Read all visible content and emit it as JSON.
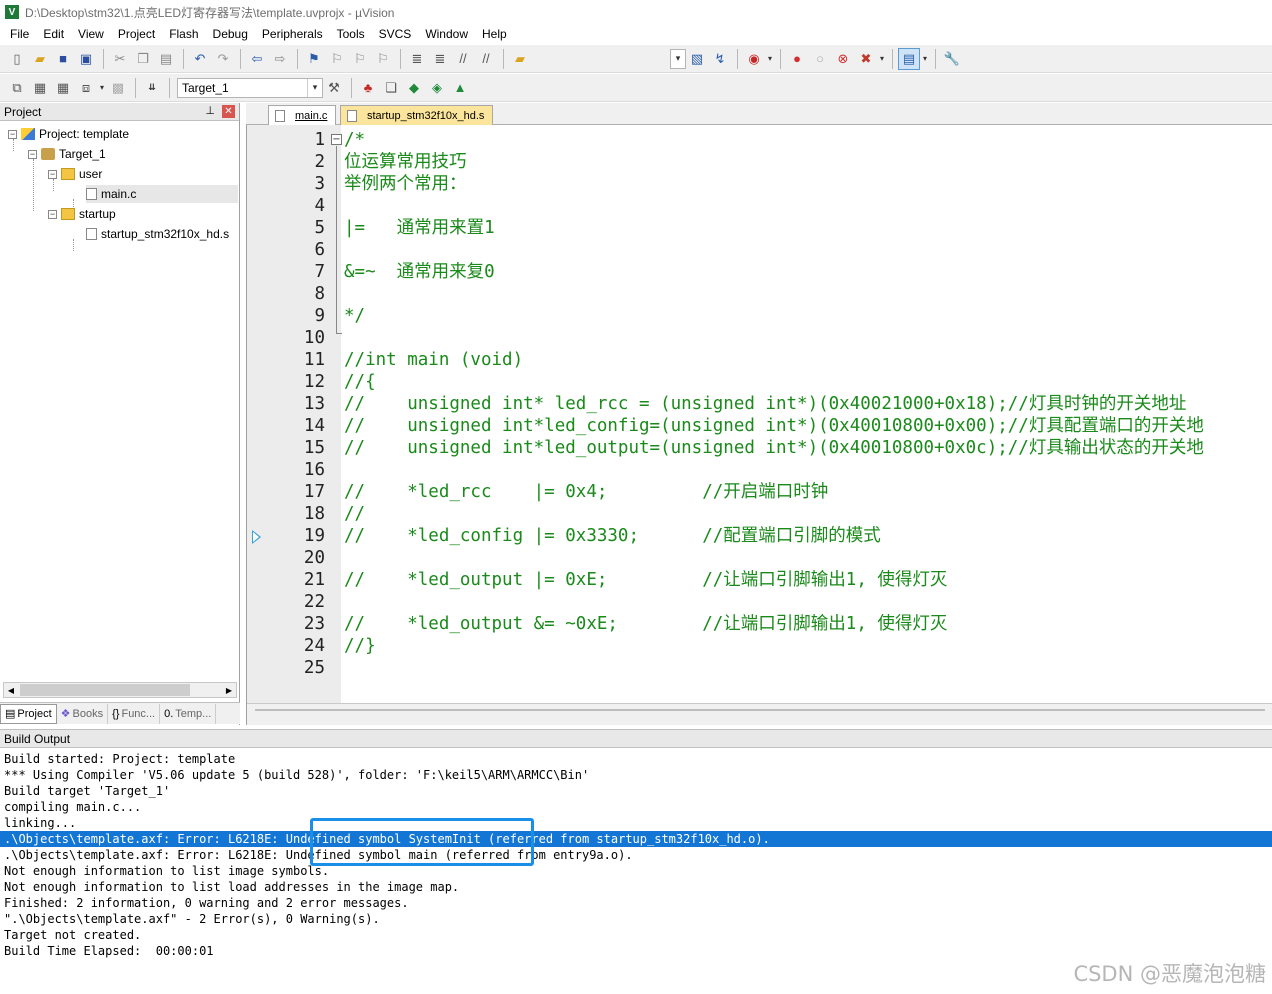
{
  "window": {
    "title": "D:\\Desktop\\stm32\\1.点亮LED灯寄存器写法\\template.uvprojx - µVision",
    "app_icon": "V"
  },
  "menu": [
    "File",
    "Edit",
    "View",
    "Project",
    "Flash",
    "Debug",
    "Peripherals",
    "Tools",
    "SVCS",
    "Window",
    "Help"
  ],
  "toolbar": {
    "target_combo": "Target_1"
  },
  "project_panel": {
    "title": "Project",
    "tree": {
      "project": "Project: template",
      "target": "Target_1",
      "group_user": "user",
      "file_main": "main.c",
      "group_startup": "startup",
      "file_startup": "startup_stm32f10x_hd.s"
    },
    "bottom_tabs": [
      "Project",
      "Books",
      "Func...",
      "Temp..."
    ]
  },
  "editor": {
    "tabs": [
      "main.c",
      "startup_stm32f10x_hd.s"
    ],
    "active_tab": "main.c",
    "lines": [
      "/*",
      "位运算常用技巧",
      "举例两个常用：",
      "",
      "|=   通常用来置1",
      "",
      "&=~  通常用来复0",
      "",
      "*/",
      "",
      "//int main (void)",
      "//{",
      "//    unsigned int* led_rcc = (unsigned int*)(0x40021000+0x18);//灯具时钟的开关地址",
      "//    unsigned int*led_config=(unsigned int*)(0x40010800+0x00);//灯具配置端口的开关地",
      "//    unsigned int*led_output=(unsigned int*)(0x40010800+0x0c);//灯具输出状态的开关地",
      "",
      "//    *led_rcc    |= 0x4;         //开启端口时钟",
      "//",
      "//    *led_config |= 0x3330;      //配置端口引脚的模式",
      "",
      "//    *led_output |= 0xE;         //让端口引脚输出1, 使得灯灭",
      "",
      "//    *led_output &= ~0xE;        //让端口引脚输出1, 使得灯灭",
      "//}",
      ""
    ],
    "line_numbers": [
      "1",
      "2",
      "3",
      "4",
      "5",
      "6",
      "7",
      "8",
      "9",
      "10",
      "11",
      "12",
      "13",
      "14",
      "15",
      "16",
      "17",
      "18",
      "19",
      "20",
      "21",
      "22",
      "23",
      "24",
      "25"
    ],
    "current_line": 19
  },
  "build_output": {
    "title": "Build Output",
    "lines": [
      "Build started: Project: template",
      "*** Using Compiler 'V5.06 update 5 (build 528)', folder: 'F:\\keil5\\ARM\\ARMCC\\Bin'",
      "Build target 'Target_1'",
      "compiling main.c...",
      "linking...",
      ".\\Objects\\template.axf: Error: L6218E: Undefined symbol SystemInit (referred from startup_stm32f10x_hd.o).",
      ".\\Objects\\template.axf: Error: L6218E: Undefined symbol main (referred from entry9a.o).",
      "Not enough information to list image symbols.",
      "Not enough information to list load addresses in the image map.",
      "Finished: 2 information, 0 warning and 2 error messages.",
      "\".\\Objects\\template.axf\" - 2 Error(s), 0 Warning(s).",
      "Target not created.",
      "Build Time Elapsed:  00:00:01"
    ],
    "selected_line": 6
  },
  "watermark": "CSDN @恶魔泡泡糖",
  "colors": {
    "code_comment": "#1a8a1a",
    "selection": "#1376d5",
    "highlight_box": "#1a8fe8"
  }
}
